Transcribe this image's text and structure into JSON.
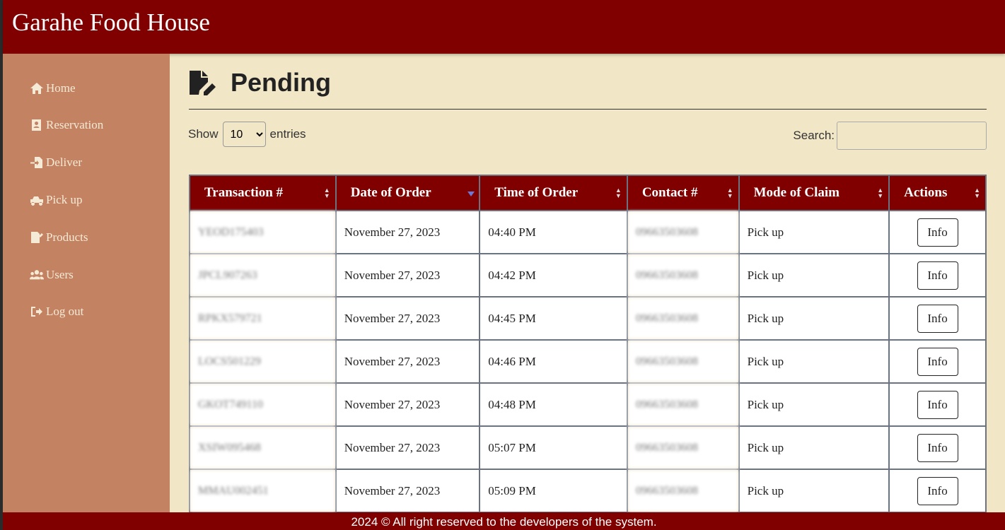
{
  "app": {
    "title": "Garahe Food House"
  },
  "sidebar": {
    "items": [
      {
        "label": "Home",
        "icon": "home-icon"
      },
      {
        "label": "Reservation",
        "icon": "contact-card-icon"
      },
      {
        "label": "Deliver",
        "icon": "file-import-icon"
      },
      {
        "label": "Pick up",
        "icon": "truck-pickup-icon"
      },
      {
        "label": "Products",
        "icon": "file-signature-icon"
      },
      {
        "label": "Users",
        "icon": "users-icon"
      },
      {
        "label": "Log out",
        "icon": "sign-out-icon"
      }
    ]
  },
  "page": {
    "title": "Pending",
    "icon": "file-edit-icon"
  },
  "controls": {
    "show_label": "Show",
    "entries_value": "10",
    "entries_label": "entries",
    "search_label": "Search:"
  },
  "table": {
    "columns": [
      "Transaction #",
      "Date of Order",
      "Time of Order",
      "Contact #",
      "Mode of Claim",
      "Actions"
    ],
    "rows": [
      {
        "transaction": "YEOD175403",
        "date": "November 27, 2023",
        "time": "04:40 PM",
        "contact": "09663503608",
        "mode": "Pick up",
        "action": "Info"
      },
      {
        "transaction": "JPCL907263",
        "date": "November 27, 2023",
        "time": "04:42 PM",
        "contact": "09663503608",
        "mode": "Pick up",
        "action": "Info"
      },
      {
        "transaction": "RPKX579721",
        "date": "November 27, 2023",
        "time": "04:45 PM",
        "contact": "09663503608",
        "mode": "Pick up",
        "action": "Info"
      },
      {
        "transaction": "LOCS501229",
        "date": "November 27, 2023",
        "time": "04:46 PM",
        "contact": "09663503608",
        "mode": "Pick up",
        "action": "Info"
      },
      {
        "transaction": "GKOT749110",
        "date": "November 27, 2023",
        "time": "04:48 PM",
        "contact": "09663503608",
        "mode": "Pick up",
        "action": "Info"
      },
      {
        "transaction": "XSIW095468",
        "date": "November 27, 2023",
        "time": "05:07 PM",
        "contact": "09663503608",
        "mode": "Pick up",
        "action": "Info"
      },
      {
        "transaction": "MMAU002451",
        "date": "November 27, 2023",
        "time": "05:09 PM",
        "contact": "09663503608",
        "mode": "Pick up",
        "action": "Info"
      }
    ]
  },
  "footer": {
    "text": "2024 © All right reserved to the developers of the system."
  },
  "colors": {
    "primary": "#800000",
    "sidebar": "#c38262",
    "background": "#f1e6c6"
  }
}
